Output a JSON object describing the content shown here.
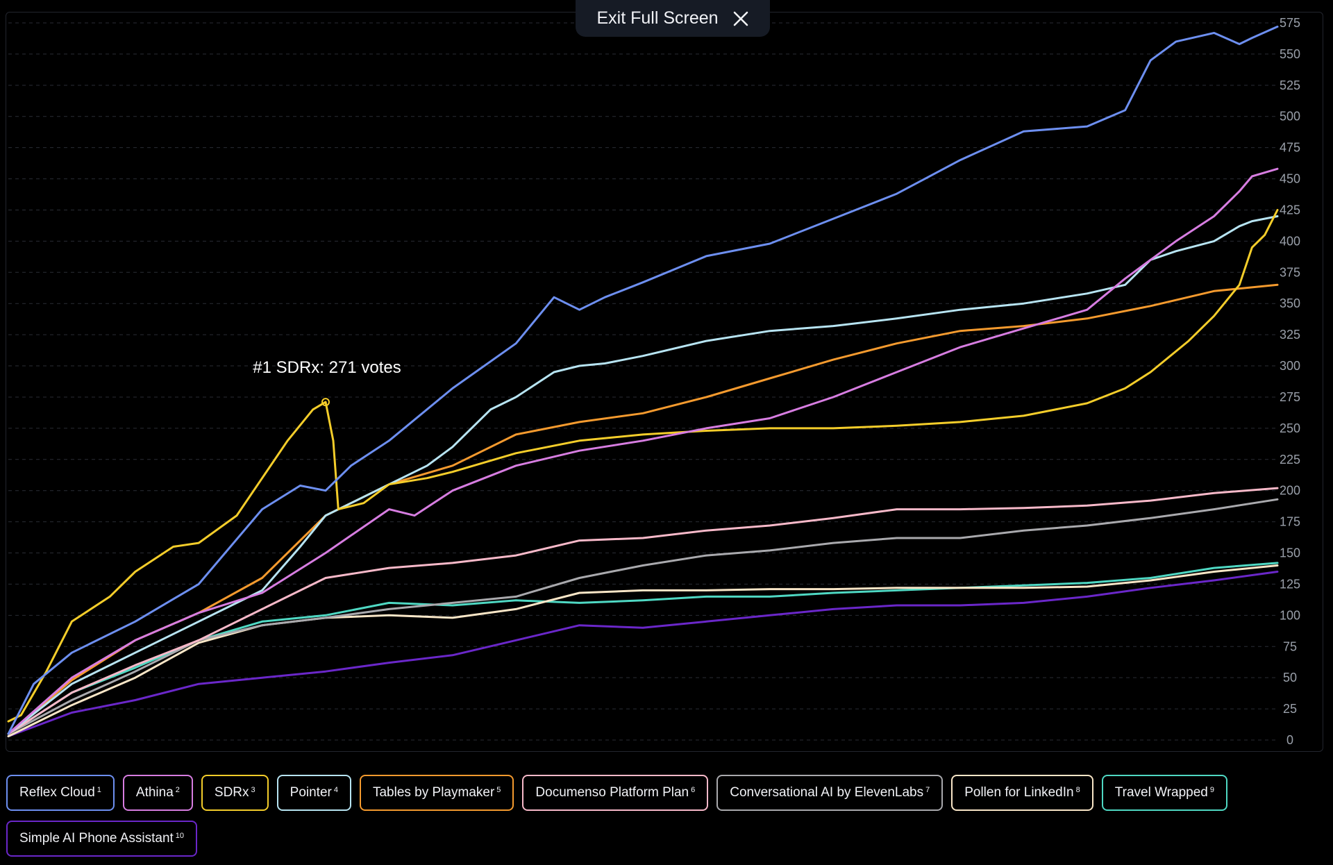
{
  "exit_button": {
    "label": "Exit Full Screen",
    "icon": "close-icon"
  },
  "chart_data": {
    "type": "line",
    "title": "",
    "xlabel": "",
    "ylabel": "",
    "ylim": [
      0,
      575
    ],
    "y_ticks": [
      0,
      25,
      50,
      75,
      100,
      125,
      150,
      175,
      200,
      225,
      250,
      275,
      300,
      325,
      350,
      375,
      400,
      425,
      450,
      475,
      500,
      525,
      550,
      575
    ],
    "y_axis_side": "right",
    "grid": "horizontal-dashed",
    "x_domain": [
      0,
      100
    ],
    "legend_placement": "bottom",
    "annotation": {
      "text": "#1 SDRx: 271 votes",
      "series": "SDRx",
      "x": 25,
      "y": 271
    },
    "series": [
      {
        "name": "Reflex Cloud",
        "rank": "1",
        "color": "#6d8ff0",
        "x": [
          0,
          2,
          5,
          10,
          15,
          20,
          23,
          25,
          27,
          30,
          35,
          40,
          43,
          45,
          47,
          50,
          55,
          60,
          65,
          70,
          75,
          80,
          85,
          88,
          90,
          92,
          95,
          97,
          98,
          100
        ],
        "y": [
          5,
          45,
          70,
          95,
          125,
          185,
          204,
          200,
          220,
          240,
          282,
          318,
          355,
          345,
          355,
          367,
          388,
          398,
          418,
          438,
          465,
          488,
          492,
          505,
          545,
          560,
          567,
          558,
          563,
          572
        ]
      },
      {
        "name": "Athina",
        "rank": "2",
        "color": "#d77de1",
        "x": [
          0,
          5,
          10,
          15,
          20,
          25,
          30,
          32,
          35,
          40,
          45,
          50,
          55,
          60,
          65,
          70,
          75,
          80,
          85,
          88,
          90,
          92,
          95,
          97,
          98,
          100
        ],
        "y": [
          5,
          50,
          80,
          102,
          118,
          150,
          185,
          180,
          200,
          220,
          232,
          240,
          250,
          258,
          275,
          295,
          315,
          330,
          345,
          370,
          385,
          400,
          420,
          440,
          452,
          458
        ]
      },
      {
        "name": "SDRx",
        "rank": "3",
        "color": "#f4cd2a",
        "x": [
          0,
          1,
          3,
          5,
          8,
          10,
          13,
          15,
          18,
          20,
          22,
          24,
          25,
          25.6,
          26,
          28,
          30,
          33,
          35,
          40,
          45,
          50,
          55,
          60,
          65,
          70,
          75,
          80,
          85,
          88,
          90,
          93,
          95,
          97,
          98,
          99,
          100
        ],
        "y": [
          15,
          20,
          55,
          95,
          115,
          135,
          155,
          158,
          180,
          210,
          240,
          265,
          271,
          240,
          185,
          190,
          205,
          210,
          215,
          230,
          240,
          245,
          248,
          250,
          250,
          252,
          255,
          260,
          270,
          282,
          295,
          320,
          340,
          365,
          395,
          405,
          425
        ]
      },
      {
        "name": "Pointer",
        "rank": "4",
        "color": "#b7e4f2",
        "x": [
          0,
          5,
          10,
          15,
          20,
          23,
          25,
          27,
          30,
          33,
          35,
          38,
          40,
          43,
          45,
          47,
          50,
          55,
          60,
          65,
          70,
          75,
          80,
          85,
          88,
          90,
          92,
          95,
          97,
          98,
          100
        ],
        "y": [
          5,
          45,
          70,
          95,
          120,
          155,
          180,
          190,
          205,
          220,
          235,
          265,
          275,
          295,
          300,
          302,
          308,
          320,
          328,
          332,
          338,
          345,
          350,
          358,
          365,
          385,
          392,
          400,
          412,
          416,
          420
        ]
      },
      {
        "name": "Tables by Playmaker",
        "rank": "5",
        "color": "#f49a2e",
        "x": [
          0,
          5,
          10,
          15,
          20,
          25,
          30,
          35,
          40,
          45,
          50,
          55,
          60,
          65,
          70,
          75,
          80,
          85,
          90,
          95,
          100
        ],
        "y": [
          5,
          48,
          80,
          102,
          130,
          180,
          205,
          220,
          245,
          255,
          262,
          275,
          290,
          305,
          318,
          328,
          332,
          338,
          348,
          360,
          365
        ]
      },
      {
        "name": "Documenso Platform Plan",
        "rank": "6",
        "color": "#f8b9c9",
        "x": [
          0,
          5,
          10,
          15,
          20,
          25,
          30,
          35,
          40,
          45,
          50,
          55,
          60,
          65,
          70,
          75,
          80,
          85,
          90,
          95,
          100
        ],
        "y": [
          5,
          38,
          60,
          80,
          105,
          130,
          138,
          142,
          148,
          160,
          162,
          168,
          172,
          178,
          185,
          185,
          186,
          188,
          192,
          198,
          202
        ]
      },
      {
        "name": "Conversational AI by ElevenLabs",
        "rank": "7",
        "color": "#a9a9ad",
        "x": [
          0,
          5,
          10,
          15,
          20,
          25,
          30,
          35,
          40,
          45,
          50,
          55,
          60,
          65,
          70,
          75,
          80,
          85,
          90,
          95,
          100
        ],
        "y": [
          5,
          32,
          55,
          80,
          92,
          98,
          105,
          110,
          115,
          130,
          140,
          148,
          152,
          158,
          162,
          162,
          168,
          172,
          178,
          185,
          193
        ]
      },
      {
        "name": "Pollen for LinkedIn",
        "rank": "8",
        "color": "#f9e6c7",
        "x": [
          0,
          5,
          10,
          15,
          20,
          25,
          30,
          35,
          40,
          45,
          50,
          55,
          60,
          65,
          70,
          75,
          80,
          85,
          90,
          95,
          100
        ],
        "y": [
          3,
          28,
          50,
          78,
          92,
          98,
          100,
          98,
          105,
          118,
          120,
          120,
          121,
          121,
          122,
          122,
          122,
          123,
          128,
          135,
          140
        ]
      },
      {
        "name": "Travel Wrapped",
        "rank": "9",
        "color": "#4fd8c3",
        "x": [
          0,
          5,
          10,
          15,
          20,
          25,
          30,
          35,
          40,
          45,
          50,
          55,
          60,
          65,
          70,
          75,
          80,
          85,
          90,
          95,
          100
        ],
        "y": [
          5,
          38,
          58,
          80,
          95,
          100,
          110,
          108,
          112,
          110,
          112,
          115,
          115,
          118,
          120,
          122,
          124,
          126,
          130,
          138,
          142
        ]
      },
      {
        "name": "Simple AI Phone Assistant",
        "rank": "10",
        "color": "#6a27c9",
        "x": [
          0,
          5,
          10,
          15,
          20,
          25,
          30,
          35,
          40,
          45,
          50,
          55,
          60,
          65,
          70,
          75,
          80,
          85,
          90,
          95,
          100
        ],
        "y": [
          3,
          22,
          32,
          45,
          50,
          55,
          62,
          68,
          80,
          92,
          90,
          95,
          100,
          105,
          108,
          108,
          110,
          115,
          122,
          128,
          135
        ]
      }
    ]
  }
}
